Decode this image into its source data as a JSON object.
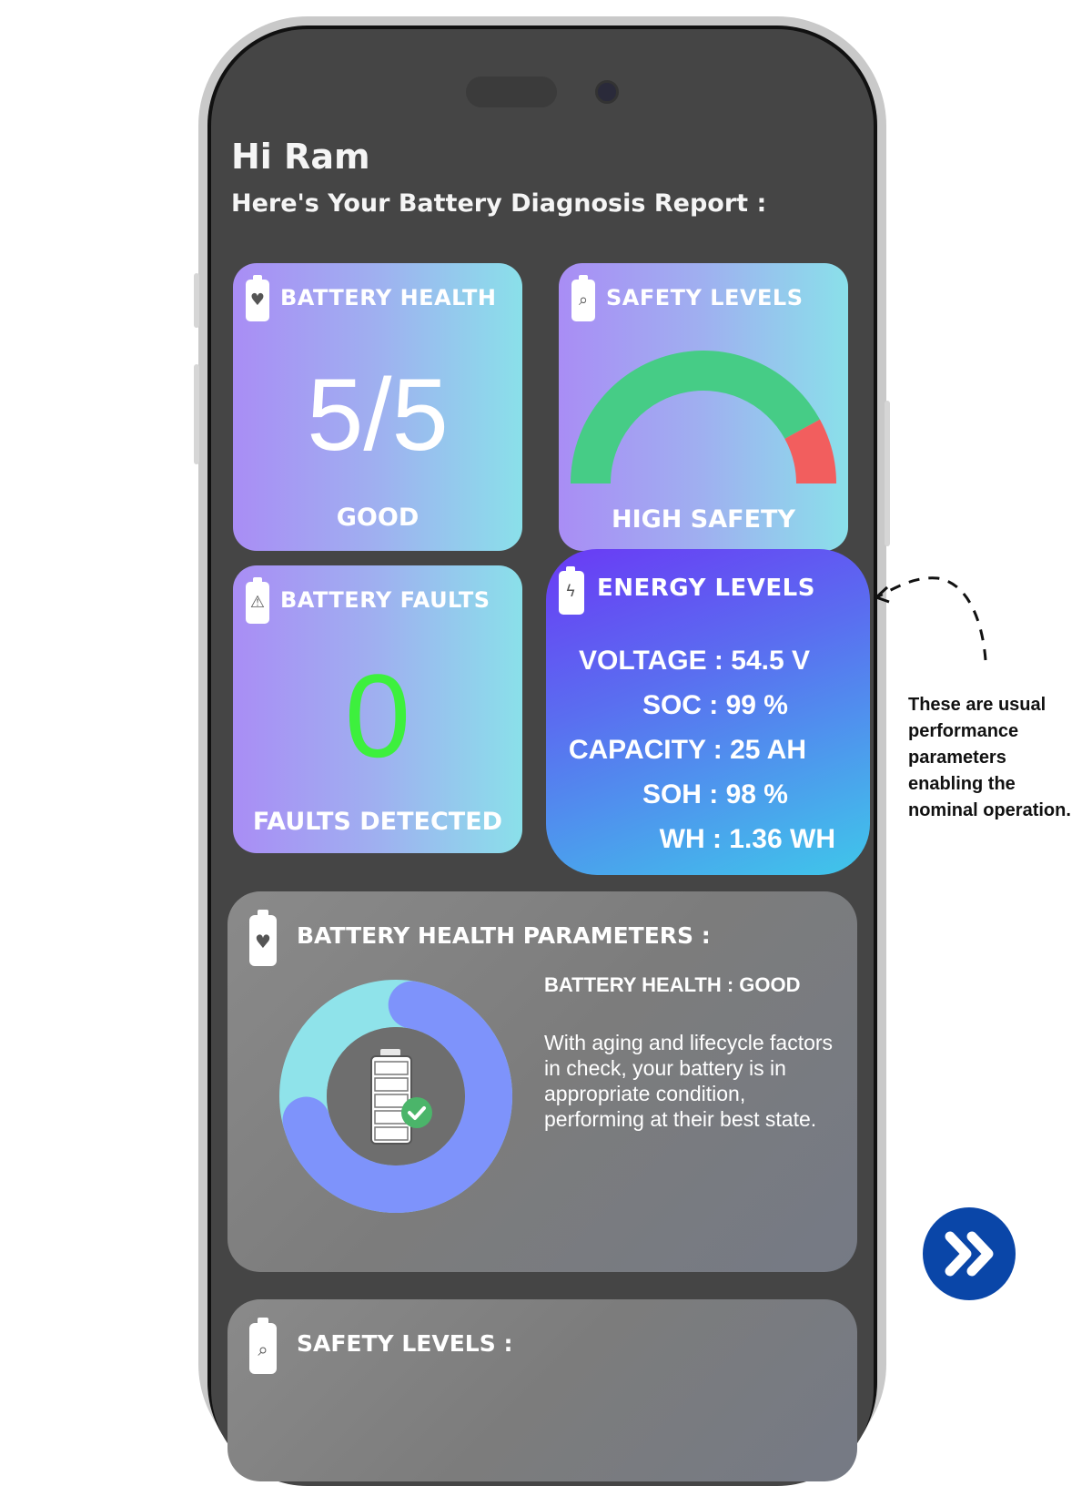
{
  "greeting": "Hi Ram",
  "subtitle": "Here's Your Battery Diagnosis Report :",
  "cards": {
    "battery_health": {
      "title": "BATTERY HEALTH",
      "value": "5/5",
      "status": "GOOD"
    },
    "safety_levels": {
      "title": "SAFETY LEVELS",
      "status": "HIGH SAFETY",
      "gauge": {
        "safe_fraction": 0.84,
        "safe_color": "#46cc86",
        "risk_color": "#f25e5e"
      }
    },
    "battery_faults": {
      "title": "BATTERY FAULTS",
      "value": "0",
      "status": "FAULTS DETECTED"
    },
    "energy_levels": {
      "title": "ENERGY LEVELS",
      "rows": [
        "VOLTAGE : 54.5 V",
        "SOC : 99 %",
        "CAPACITY : 25 AH",
        "SOH : 98 %",
        "WH : 1.36 WH"
      ]
    }
  },
  "health_parameters": {
    "title": "BATTERY HEALTH PARAMETERS :",
    "status": "BATTERY HEALTH : GOOD",
    "description": "With aging and lifecycle factors in check, your battery is in appropriate condition, performing at their best state.",
    "donut": {
      "fraction": 0.68,
      "main_color": "#7e93fb",
      "rest_color": "#8fe3ea"
    }
  },
  "safety_section": {
    "title": "SAFETY LEVELS :"
  },
  "annotation": "These are usual performance parameters enabling the nominal operation.",
  "colors": {
    "screen": "#454545",
    "accent_button": "#0a46a8",
    "fault_zero": "#3df03d"
  },
  "icons": [
    "battery-heart-icon",
    "battery-magnifier-icon",
    "battery-warning-icon",
    "battery-charge-icon",
    "battery-check-icon",
    "double-chevron-right-icon"
  ]
}
